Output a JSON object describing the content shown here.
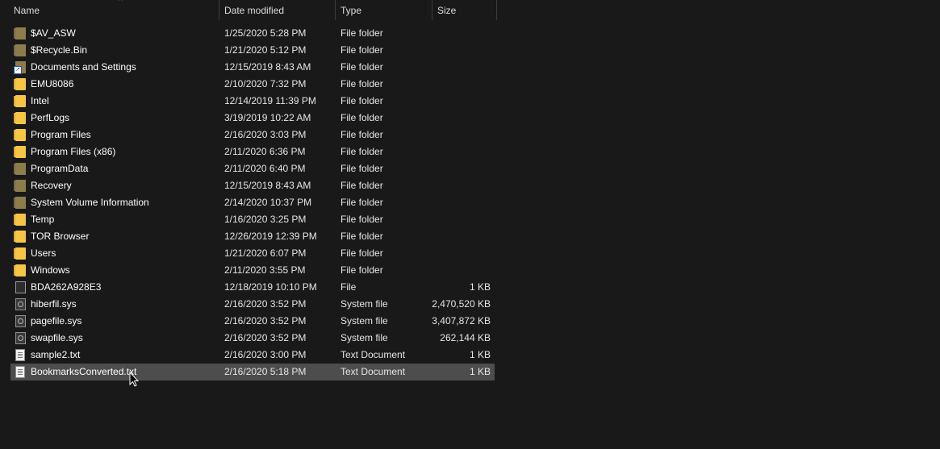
{
  "columns": {
    "name": "Name",
    "date": "Date modified",
    "type": "Type",
    "size": "Size"
  },
  "sort_indicator": "^",
  "files": [
    {
      "name": "$AV_ASW",
      "date": "1/25/2020 5:28 PM",
      "type": "File folder",
      "size": "",
      "icon": "folder-dim-icon"
    },
    {
      "name": "$Recycle.Bin",
      "date": "1/21/2020 5:12 PM",
      "type": "File folder",
      "size": "",
      "icon": "folder-dim-icon"
    },
    {
      "name": "Documents and Settings",
      "date": "12/15/2019 8:43 AM",
      "type": "File folder",
      "size": "",
      "icon": "folder-link-icon"
    },
    {
      "name": "EMU8086",
      "date": "2/10/2020 7:32 PM",
      "type": "File folder",
      "size": "",
      "icon": "folder-icon"
    },
    {
      "name": "Intel",
      "date": "12/14/2019 11:39 PM",
      "type": "File folder",
      "size": "",
      "icon": "folder-icon"
    },
    {
      "name": "PerfLogs",
      "date": "3/19/2019 10:22 AM",
      "type": "File folder",
      "size": "",
      "icon": "folder-icon"
    },
    {
      "name": "Program Files",
      "date": "2/16/2020 3:03 PM",
      "type": "File folder",
      "size": "",
      "icon": "folder-icon"
    },
    {
      "name": "Program Files (x86)",
      "date": "2/11/2020 6:36 PM",
      "type": "File folder",
      "size": "",
      "icon": "folder-icon"
    },
    {
      "name": "ProgramData",
      "date": "2/11/2020 6:40 PM",
      "type": "File folder",
      "size": "",
      "icon": "folder-dim-icon"
    },
    {
      "name": "Recovery",
      "date": "12/15/2019 8:43 AM",
      "type": "File folder",
      "size": "",
      "icon": "folder-dim-icon"
    },
    {
      "name": "System Volume Information",
      "date": "2/14/2020 10:37 PM",
      "type": "File folder",
      "size": "",
      "icon": "folder-dim-icon"
    },
    {
      "name": "Temp",
      "date": "1/16/2020 3:25 PM",
      "type": "File folder",
      "size": "",
      "icon": "folder-icon"
    },
    {
      "name": "TOR Browser",
      "date": "12/26/2019 12:39 PM",
      "type": "File folder",
      "size": "",
      "icon": "folder-icon"
    },
    {
      "name": "Users",
      "date": "1/21/2020 6:07 PM",
      "type": "File folder",
      "size": "",
      "icon": "folder-icon"
    },
    {
      "name": "Windows",
      "date": "2/11/2020 3:55 PM",
      "type": "File folder",
      "size": "",
      "icon": "folder-icon"
    },
    {
      "name": "BDA262A928E3",
      "date": "12/18/2019 10:10 PM",
      "type": "File",
      "size": "1 KB",
      "icon": "file-icon"
    },
    {
      "name": "hiberfil.sys",
      "date": "2/16/2020 3:52 PM",
      "type": "System file",
      "size": "2,470,520 KB",
      "icon": "system-file-icon"
    },
    {
      "name": "pagefile.sys",
      "date": "2/16/2020 3:52 PM",
      "type": "System file",
      "size": "3,407,872 KB",
      "icon": "system-file-icon"
    },
    {
      "name": "swapfile.sys",
      "date": "2/16/2020 3:52 PM",
      "type": "System file",
      "size": "262,144 KB",
      "icon": "system-file-icon"
    },
    {
      "name": "sample2.txt",
      "date": "2/16/2020 3:00 PM",
      "type": "Text Document",
      "size": "1 KB",
      "icon": "text-file-icon"
    },
    {
      "name": "BookmarksConverted.txt",
      "date": "2/16/2020 5:18 PM",
      "type": "Text Document",
      "size": "1 KB",
      "icon": "text-file-icon",
      "selected": true
    }
  ],
  "colors": {
    "background": "#191919",
    "selection": "#4d4d4d",
    "folder": "#f5c645",
    "folder_dim": "#8d7d4c"
  }
}
